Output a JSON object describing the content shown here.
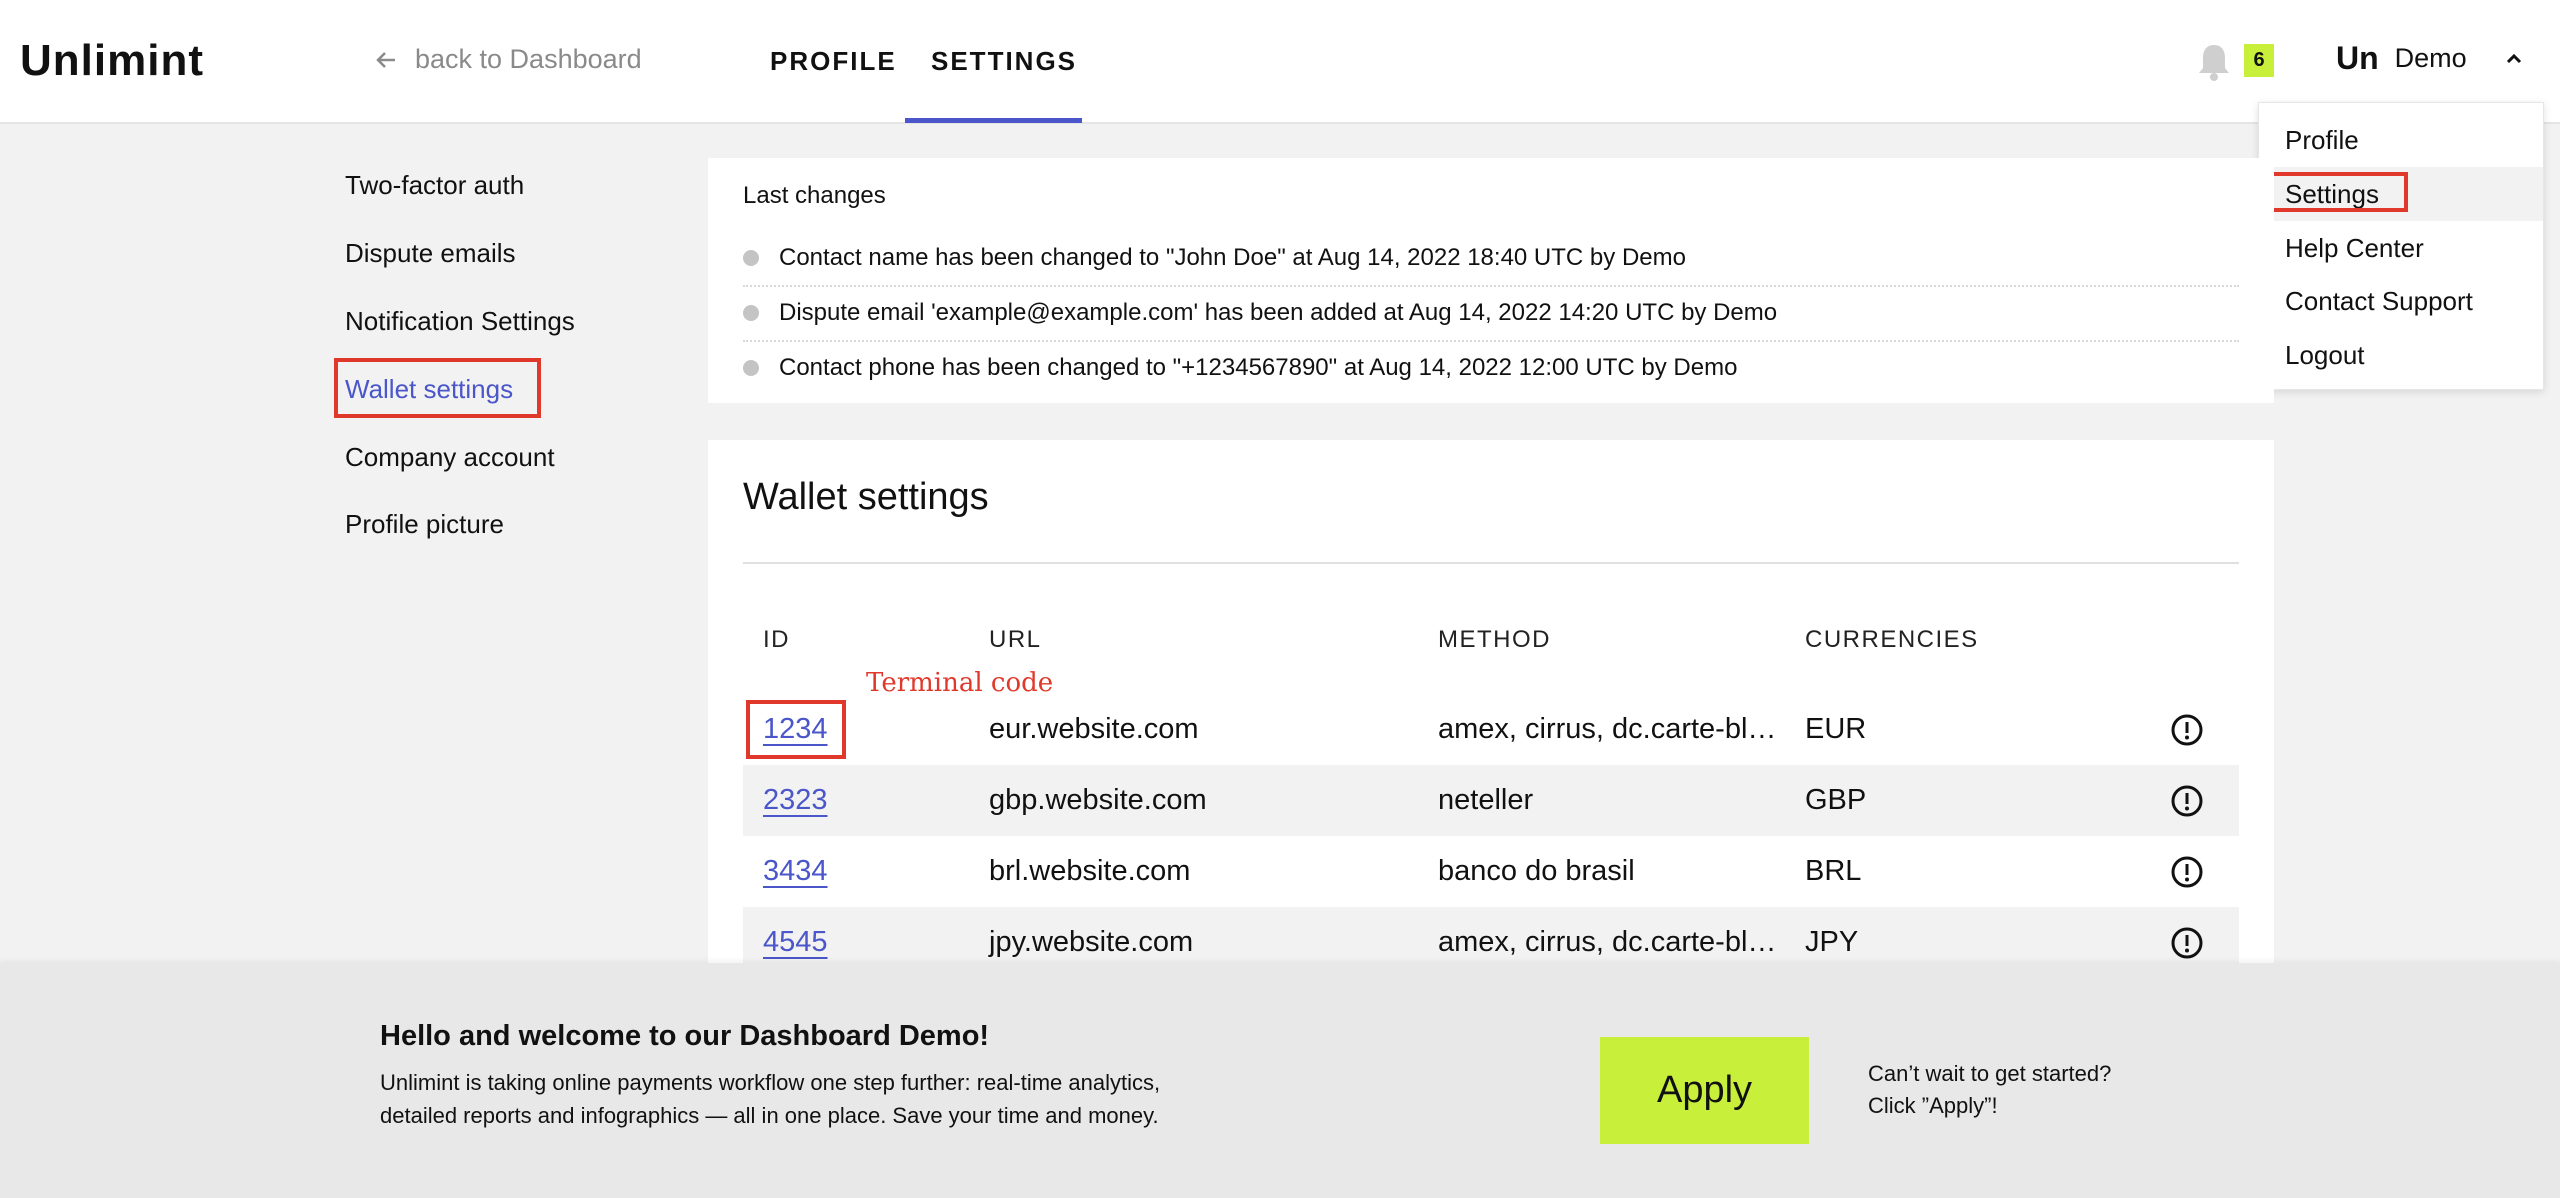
{
  "header": {
    "logo": "Unlimint",
    "back_label": "back to Dashboard",
    "tabs": [
      {
        "label": "PROFILE"
      },
      {
        "label": "SETTINGS",
        "active": true
      }
    ],
    "notifications_count": "6",
    "user_mark": "Un",
    "user_name": "Demo"
  },
  "user_menu": {
    "items": [
      {
        "label": "Profile"
      },
      {
        "label": "Settings",
        "selected": true
      },
      {
        "label": "Help Center"
      },
      {
        "label": "Contact Support"
      },
      {
        "label": "Logout"
      }
    ]
  },
  "sidebar": {
    "items": [
      {
        "label": "Two-factor auth"
      },
      {
        "label": "Dispute emails"
      },
      {
        "label": "Notification Settings"
      },
      {
        "label": "Wallet settings",
        "active": true
      },
      {
        "label": "Company account"
      },
      {
        "label": "Profile picture"
      }
    ]
  },
  "last_changes": {
    "title": "Last changes",
    "items": [
      "Contact name has been changed to \"John Doe\" at Aug 14, 2022 18:40 UTC by Demo",
      "Dispute email 'example@example.com' has been added at Aug 14, 2022 14:20 UTC by Demo",
      "Contact phone has been changed to \"+1234567890\" at Aug 14, 2022 12:00 UTC by Demo"
    ]
  },
  "wallet": {
    "title": "Wallet settings",
    "columns": [
      "ID",
      "URL",
      "METHOD",
      "CURRENCIES"
    ],
    "annotation": "Terminal code",
    "rows": [
      {
        "id": "1234",
        "url": "eur.website.com",
        "method": "amex, cirrus, dc.carte-bl…",
        "currency": "EUR"
      },
      {
        "id": "2323",
        "url": "gbp.website.com",
        "method": "neteller",
        "currency": "GBP"
      },
      {
        "id": "3434",
        "url": "brl.website.com",
        "method": "banco do brasil",
        "currency": "BRL"
      },
      {
        "id": "4545",
        "url": "jpy.website.com",
        "method": "amex, cirrus, dc.carte-bl…",
        "currency": "JPY"
      }
    ]
  },
  "banner": {
    "title": "Hello and welcome to our Dashboard Demo!",
    "text": "Unlimint is taking online payments workflow one step further: real-time analytics, detailed reports and infographics — all in one place. Save your time and money.",
    "apply_label": "Apply",
    "cta_line1": "Can’t wait to get started?",
    "cta_line2": "Click ”Apply”!"
  },
  "colors": {
    "accent": "#4a56c9",
    "highlight": "#c8f03a",
    "annotation_red": "#e0392b"
  }
}
